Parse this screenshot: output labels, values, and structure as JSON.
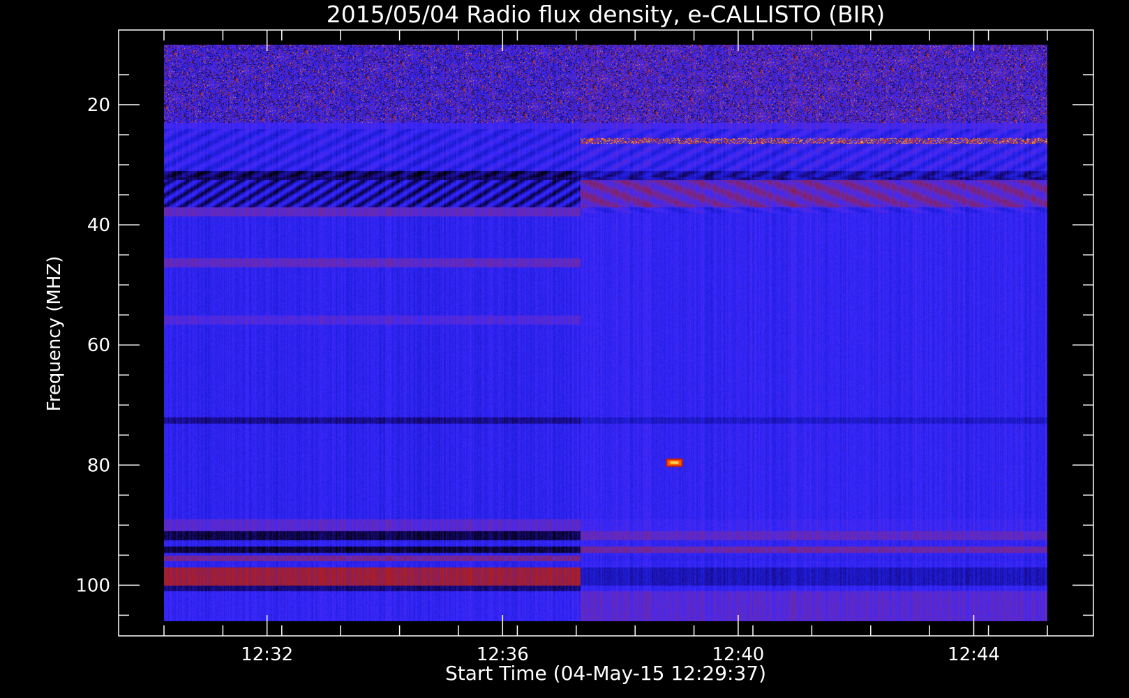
{
  "chart_data": {
    "type": "heatmap",
    "title": "2015/05/04  Radio flux density, e-CALLISTO (BIR)",
    "xlabel": "Start Time (04-May-15 12:29:37)",
    "ylabel": "Frequency (MHZ)",
    "x_ticks": [
      "12:32",
      "12:36",
      "12:40",
      "12:44"
    ],
    "x_tick_minutes": [
      2.383,
      6.383,
      10.383,
      14.383
    ],
    "x_data_range_minutes": [
      0.633,
      15.633
    ],
    "y_ticks": [
      20,
      40,
      60,
      80,
      100
    ],
    "y_data_range": [
      10,
      106
    ],
    "ylim": [
      8,
      108
    ],
    "y_inverted": true,
    "colormap": [
      "#000000",
      "#1a0a8c",
      "#1e1edc",
      "#3c28ff",
      "#6a2ab4",
      "#8c1e50",
      "#c81e00",
      "#ff5a00",
      "#ffd250",
      "#ffffb4"
    ],
    "background": "#000000",
    "axis_color": "#ffffff",
    "features": [
      {
        "kind": "instrument_step",
        "at_minute": 7.7
      },
      {
        "kind": "burst",
        "minute": 9.3,
        "freq": 79.6
      }
    ]
  }
}
